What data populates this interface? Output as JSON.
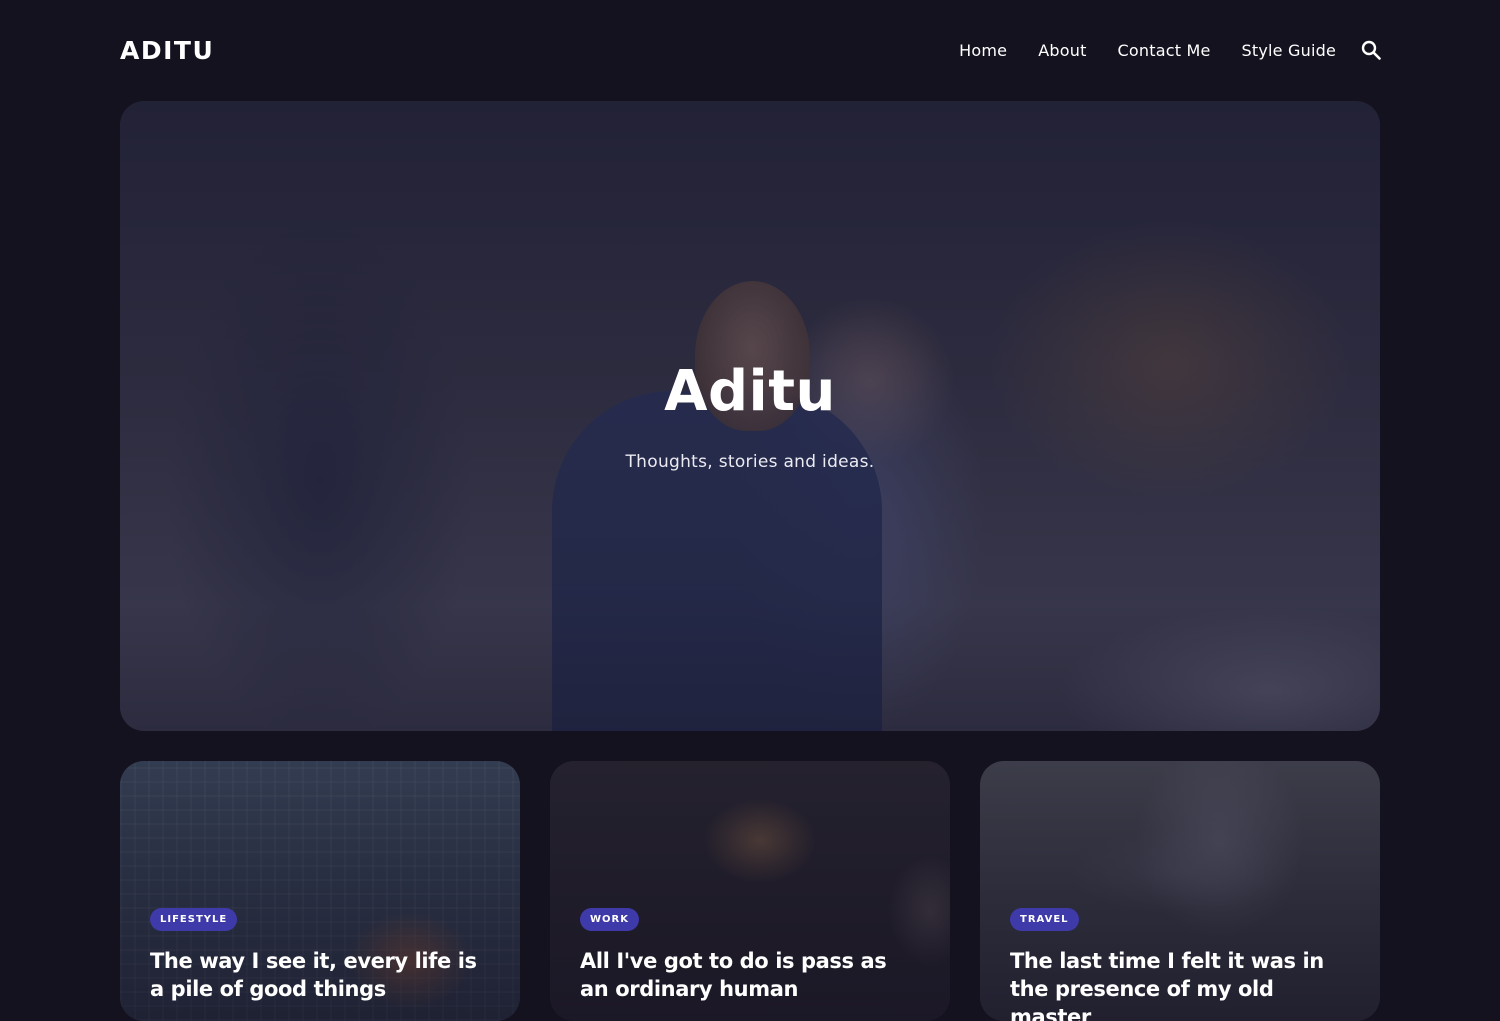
{
  "header": {
    "logo": "ADITU",
    "nav": [
      {
        "label": "Home"
      },
      {
        "label": "About"
      },
      {
        "label": "Contact Me"
      },
      {
        "label": "Style Guide"
      }
    ],
    "search_icon": "search-icon"
  },
  "hero": {
    "title": "Aditu",
    "tagline": "Thoughts, stories and ideas."
  },
  "posts": [
    {
      "tag": "LIFESTYLE",
      "title": "The way I see it, every life is a pile of good things"
    },
    {
      "tag": "WORK",
      "title": "All I've got to do is pass as an ordinary human"
    },
    {
      "tag": "TRAVEL",
      "title": "The last time I felt it was in the presence of my old master"
    }
  ],
  "colors": {
    "background": "#15121f",
    "badge": "#3f3aa9",
    "text": "#ffffff"
  }
}
